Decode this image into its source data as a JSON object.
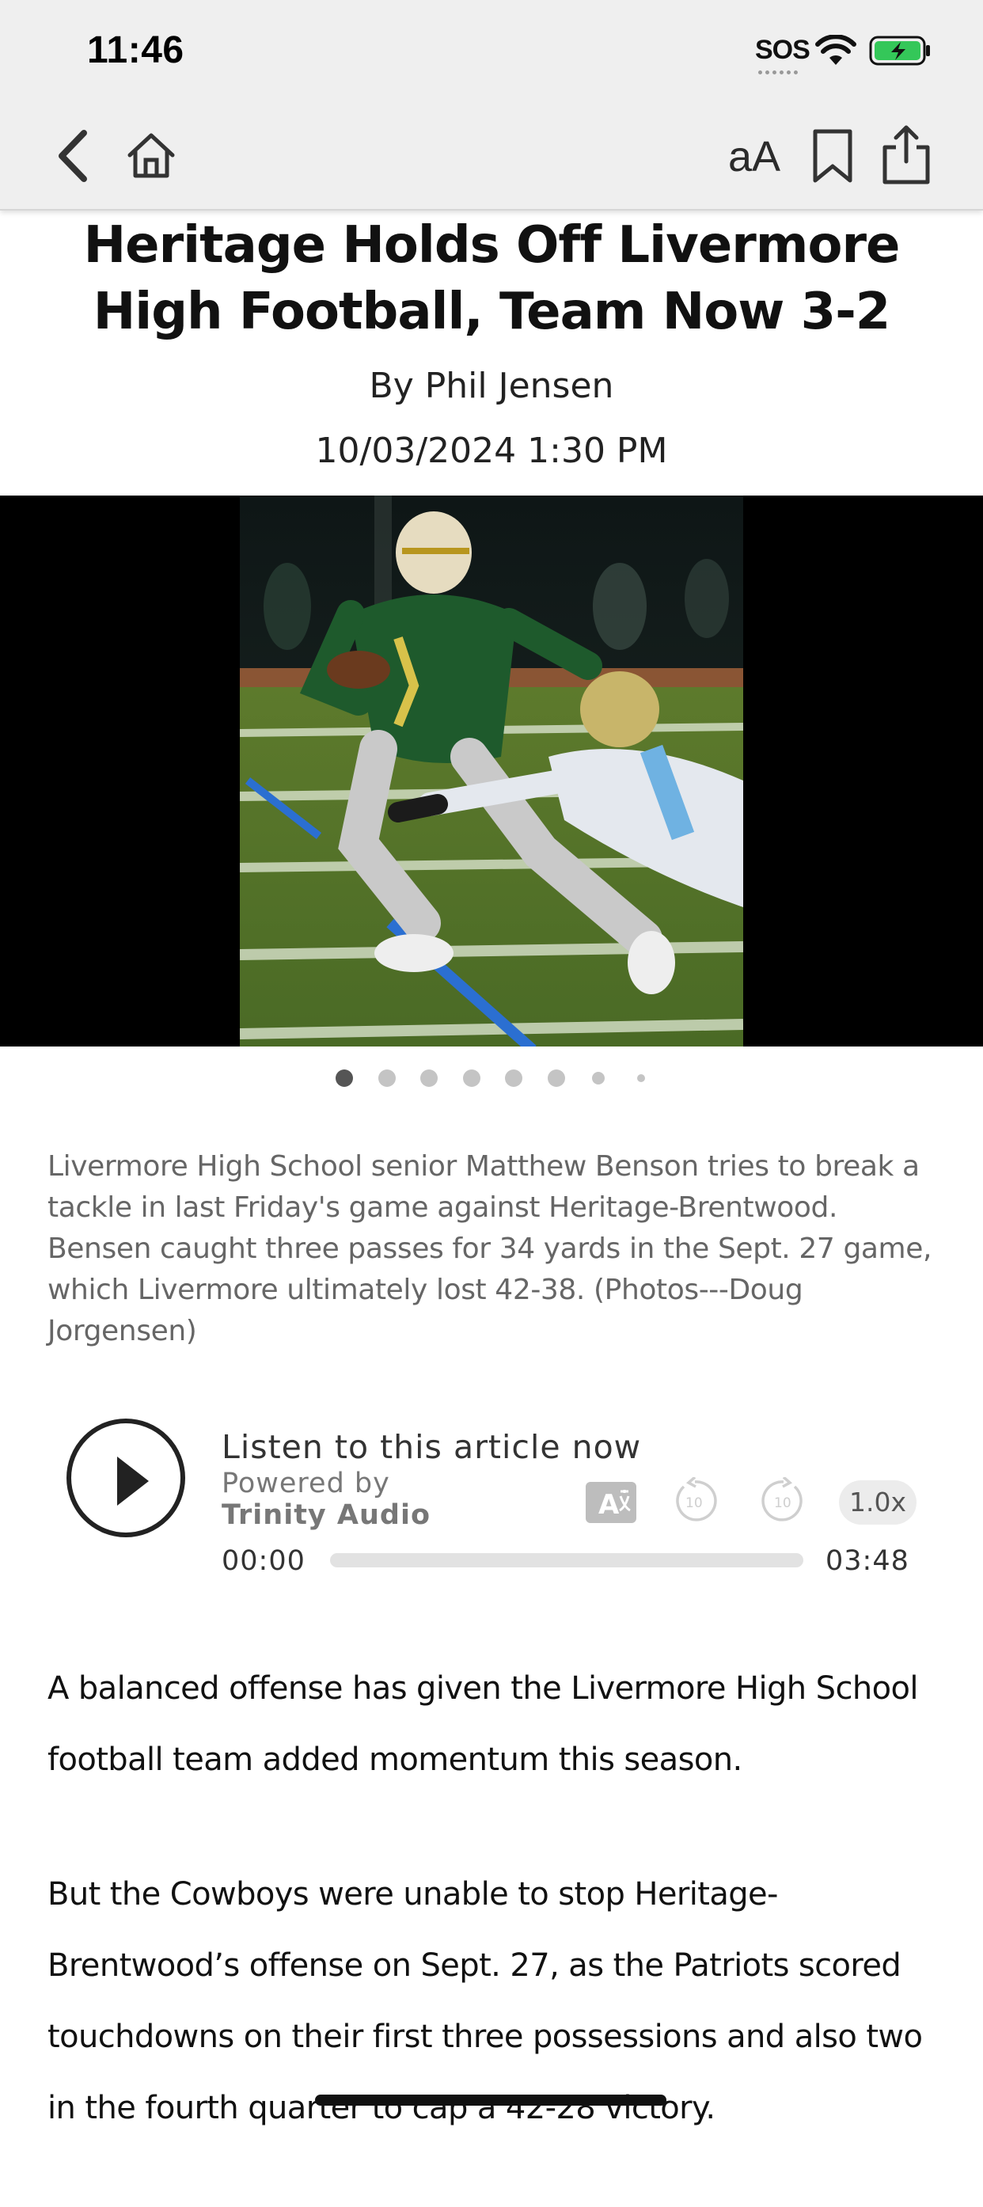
{
  "status_bar": {
    "time": "11:46",
    "sos": "SOS",
    "wifi_icon": "wifi-icon",
    "battery_icon": "battery-charging-icon",
    "battery_color": "#34c759"
  },
  "toolbar": {
    "back_icon": "chevron-left-icon",
    "home_icon": "home-icon",
    "font_size_label": "aA",
    "bookmark_icon": "bookmark-icon",
    "share_icon": "share-icon"
  },
  "article": {
    "title": "Heritage Holds Off Livermore High Football, Team Now 3-2",
    "byline": "By Phil Jensen",
    "date": "10/03/2024 1:30 PM",
    "caption": "Livermore High School senior Matthew Benson tries to break a tackle in last Friday's game against Heritage-Brentwood. Bensen caught three passes for 34 yards in the Sept. 27 game, which Livermore ultimately lost 42-38. (Photos---Doug Jorgensen)",
    "paragraphs": [
      "A balanced offense has given the Livermore High School football team added momentum this season.",
      "But the Cowboys were unable to stop Heritage-Brentwood’s offense on Sept. 27, as the Patriots scored touchdowns on their first three possessions and also two in the fourth quarter to cap a 42-28 victory."
    ]
  },
  "carousel": {
    "photo_count": 8,
    "active_index": 0
  },
  "audio_player": {
    "title": "Listen to this article now",
    "powered_by": "Powered by",
    "brand": "Trinity Audio",
    "translate_label": "A",
    "rewind_label": "10",
    "forward_label": "10",
    "speed": "1.0x",
    "current_time": "00:00",
    "total_time": "03:48",
    "progress": 0
  }
}
